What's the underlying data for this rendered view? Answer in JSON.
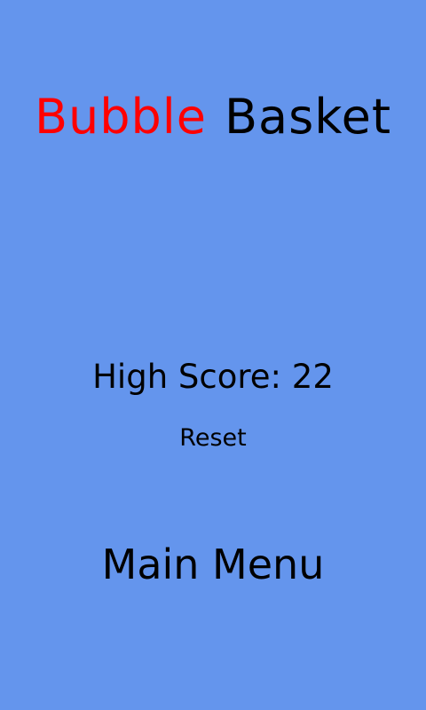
{
  "title": {
    "part1": "Bubble",
    "part2": "Basket"
  },
  "high_score": {
    "label": "High Score:",
    "value": "22"
  },
  "reset_label": "Reset",
  "main_menu_label": "Main Menu",
  "colors": {
    "background": "#6495ED",
    "title_accent": "#FF0000",
    "text": "#000000"
  }
}
